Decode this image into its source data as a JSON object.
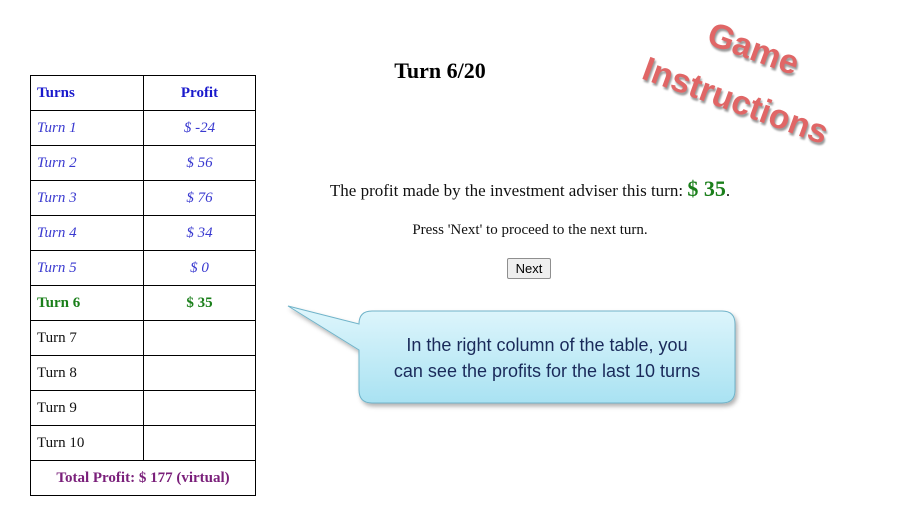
{
  "table": {
    "header": {
      "turns": "Turns",
      "profit": "Profit"
    },
    "rows": [
      {
        "turn": "Turn 1",
        "profit": "$ -24"
      },
      {
        "turn": "Turn 2",
        "profit": "$ 56"
      },
      {
        "turn": "Turn 3",
        "profit": "$ 76"
      },
      {
        "turn": "Turn 4",
        "profit": "$ 34"
      },
      {
        "turn": "Turn 5",
        "profit": "$ 0"
      },
      {
        "turn": "Turn 6",
        "profit": "$ 35"
      },
      {
        "turn": "Turn 7",
        "profit": ""
      },
      {
        "turn": "Turn 8",
        "profit": ""
      },
      {
        "turn": "Turn 9",
        "profit": ""
      },
      {
        "turn": "Turn 10",
        "profit": ""
      }
    ],
    "total": "Total Profit: $ 177 (virtual)"
  },
  "main": {
    "turn_title": "Turn 6/20",
    "profit_prefix": "The profit made by the investment adviser this turn:",
    "profit_value": "$ 35",
    "profit_suffix": ".",
    "proceed_text": "Press 'Next' to proceed to the next turn.",
    "next_label": "Next"
  },
  "game_instructions": {
    "line1": "Game",
    "line2": "Instructions"
  },
  "callout": {
    "text_line1": "In the right column of the table, you",
    "text_line2": "can see the profits for the last 10 turns"
  },
  "colors": {
    "past_turn": "#3a3ad0",
    "current_turn": "#1a7f1a",
    "total": "#7a1f7a",
    "stamp": "#e06666",
    "callout_fill": "#c9eef8"
  }
}
